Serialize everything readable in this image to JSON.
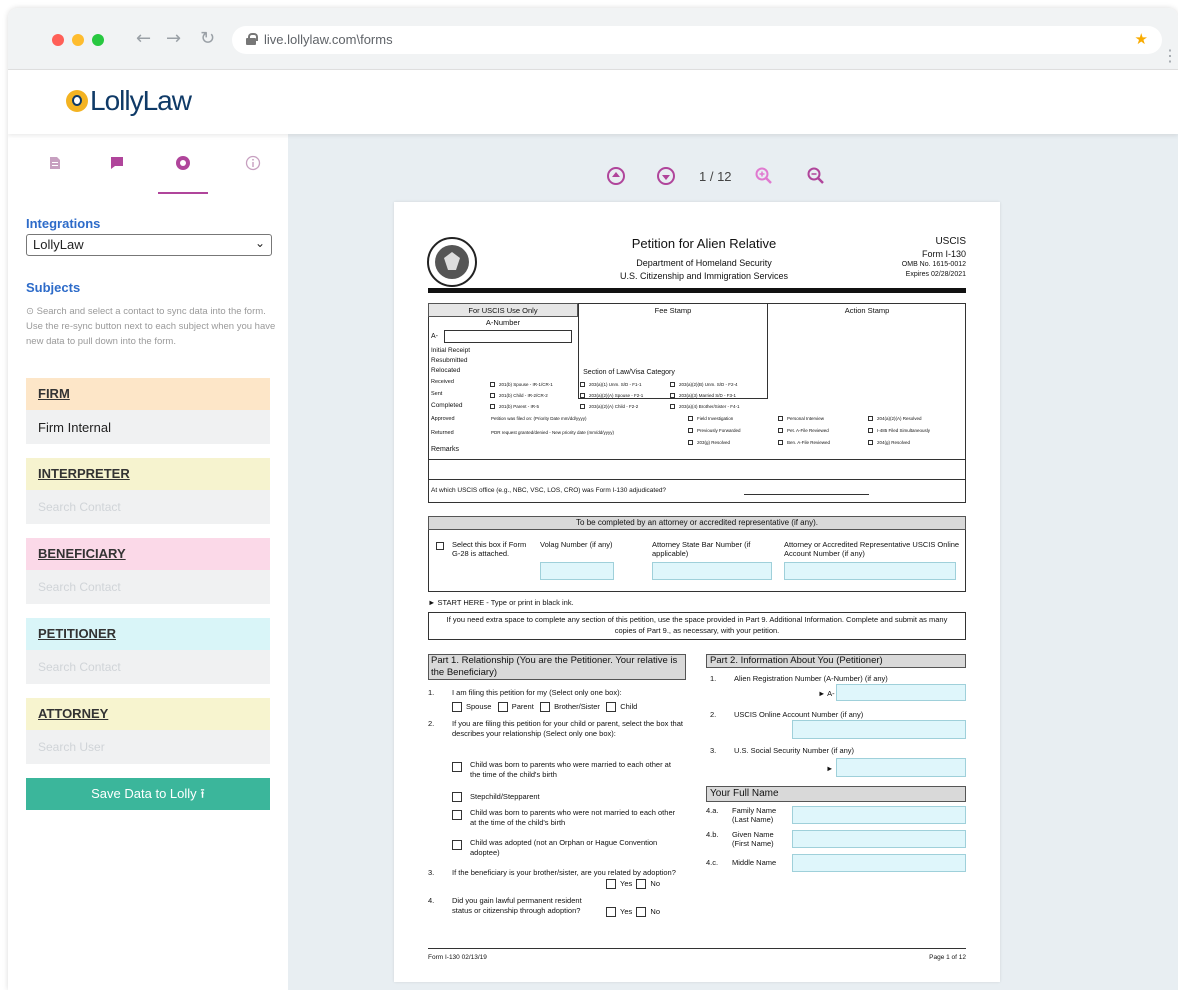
{
  "browser": {
    "url": "live.lollylaw.com\\forms"
  },
  "app": {
    "logo_text": "LollyLaw"
  },
  "sidebar": {
    "tabs": [
      "document-icon",
      "chat-icon",
      "integration-icon",
      "info-icon"
    ],
    "integrations_title": "Integrations",
    "integration_selected": "LollyLaw",
    "subjects_title": "Subjects",
    "help_text": "Search and select a contact to sync data into the form. Use the re-sync button next to each subject when you have new data to pull down into the form.",
    "subjects": [
      {
        "label": "FIRM",
        "value": "Firm Internal",
        "placeholder": "",
        "color": "#fde6c8"
      },
      {
        "label": "INTERPRETER",
        "value": "",
        "placeholder": "Search Contact",
        "color": "#f6f3cf"
      },
      {
        "label": "BENEFICIARY",
        "value": "",
        "placeholder": "Search Contact",
        "color": "#fbd9e8"
      },
      {
        "label": "PETITIONER",
        "value": "",
        "placeholder": "Search Contact",
        "color": "#d9f5f8"
      },
      {
        "label": "ATTORNEY",
        "value": "",
        "placeholder": "Search User",
        "color": "#f7f4cf"
      }
    ],
    "save_label": "Save Data to Lolly",
    "save_color": "#3bb69b"
  },
  "viewer": {
    "page_indicator": "1 / 12",
    "accent": "#b0459b"
  },
  "form": {
    "title": "Petition for Alien Relative",
    "dept": "Department of Homeland Security",
    "agency": "U.S. Citizenship and Immigration Services",
    "agency_short": "USCIS",
    "form_no": "Form I-130",
    "omb": "OMB No. 1615-0012",
    "expires": "Expires 02/28/2021",
    "office_use": "For USCIS Use Only",
    "a_number": "A-Number",
    "a_prefix": "A-",
    "fee_stamp": "Fee Stamp",
    "action_stamp": "Action Stamp",
    "initial_receipt": "Initial Receipt",
    "resubmitted": "Resubmitted",
    "relocated": "Relocated",
    "received": "Received",
    "sent": "Sent",
    "completed": "Completed",
    "approved": "Approved",
    "returned": "Returned",
    "remarks": "Remarks",
    "section_law": "Section of Law/Visa Category",
    "law_items": [
      "201(b) Spouse - IR-1/CR-1",
      "203(a)(1) Unm. S/D - F1-1",
      "203(a)(2)(B) Unm. S/D - F2-4",
      "201(b) Child - IR-2/CR-2",
      "203(a)(2)(A) Spouse - F2-1",
      "203(a)(3) Married S/D - F3-1",
      "201(b) Parent - IR-5",
      "203(a)(2)(A) Child - F2-2",
      "203(a)(4) Brother/Sister - F4-1"
    ],
    "petition_filed": "Petition was filed on: (Priority Date mm/dd/yyyy)",
    "pdr": "PDR request granted/denied - New priority date (mm/dd/yyyy)",
    "status_items": [
      "Field Investigation",
      "Personal Interview",
      "204(a)(2)(A) Resolved",
      "Previously Forwarded",
      "Pet. A-File Reviewed",
      "I-485 Filed Simultaneously",
      "203(g) Resolved",
      "Ben. A-File Reviewed",
      "204(g) Resolved"
    ],
    "adjudicated": "At which USCIS office (e.g., NBC, VSC, LOS, CRO) was Form I-130 adjudicated?",
    "attorney_header": "To be completed by an attorney or accredited representative (if any).",
    "g28": "Select this box if Form G-28 is attached.",
    "volag": "Volag Number (if any)",
    "bar_number": "Attorney State Bar Number (if applicable)",
    "online_account": "Attorney or Accredited Representative USCIS Online Account Number (if any)",
    "start_here": "START HERE - Type or print in black ink.",
    "extra_space": "If you need extra space to complete any section of this petition, use the space provided in Part 9. Additional Information. Complete and submit as many copies of Part 9., as necessary, with your petition.",
    "part1_title": "Part 1.  Relationship (You are the Petitioner.  Your relative is the Beneficiary)",
    "p1_q1": "I am filing this petition for my (Select only one box):",
    "p1_q1_opts": [
      "Spouse",
      "Parent",
      "Brother/Sister",
      "Child"
    ],
    "p1_q2": "If you are filing this petition for your child or parent, select the box that describes your relationship (Select only one box):",
    "p1_q2_opts": [
      "Child was born to parents who were married to each other at the time of the child's birth",
      "Stepchild/Stepparent",
      "Child was born to parents who were not married to each other at the time of the child's birth",
      "Child was adopted (not an Orphan or Hague Convention adoptee)"
    ],
    "p1_q3": "If the beneficiary is your brother/sister, are you related by adoption?",
    "p1_q4": "Did you gain lawful permanent resident status or citizenship through adoption?",
    "yes": "Yes",
    "no": "No",
    "part2_title": "Part 2.  Information About You (Petitioner)",
    "p2_q1": "Alien Registration Number (A-Number) (if any)",
    "p2_q2": "USCIS Online Account Number (if any)",
    "p2_q3": "U.S. Social Security Number (if any)",
    "full_name": "Your Full Name",
    "family_name": "Family Name (Last Name)",
    "given_name": "Given Name (First Name)",
    "middle_name": "Middle Name",
    "footer_left": "Form I-130  02/13/19",
    "footer_right": "Page 1 of 12"
  }
}
